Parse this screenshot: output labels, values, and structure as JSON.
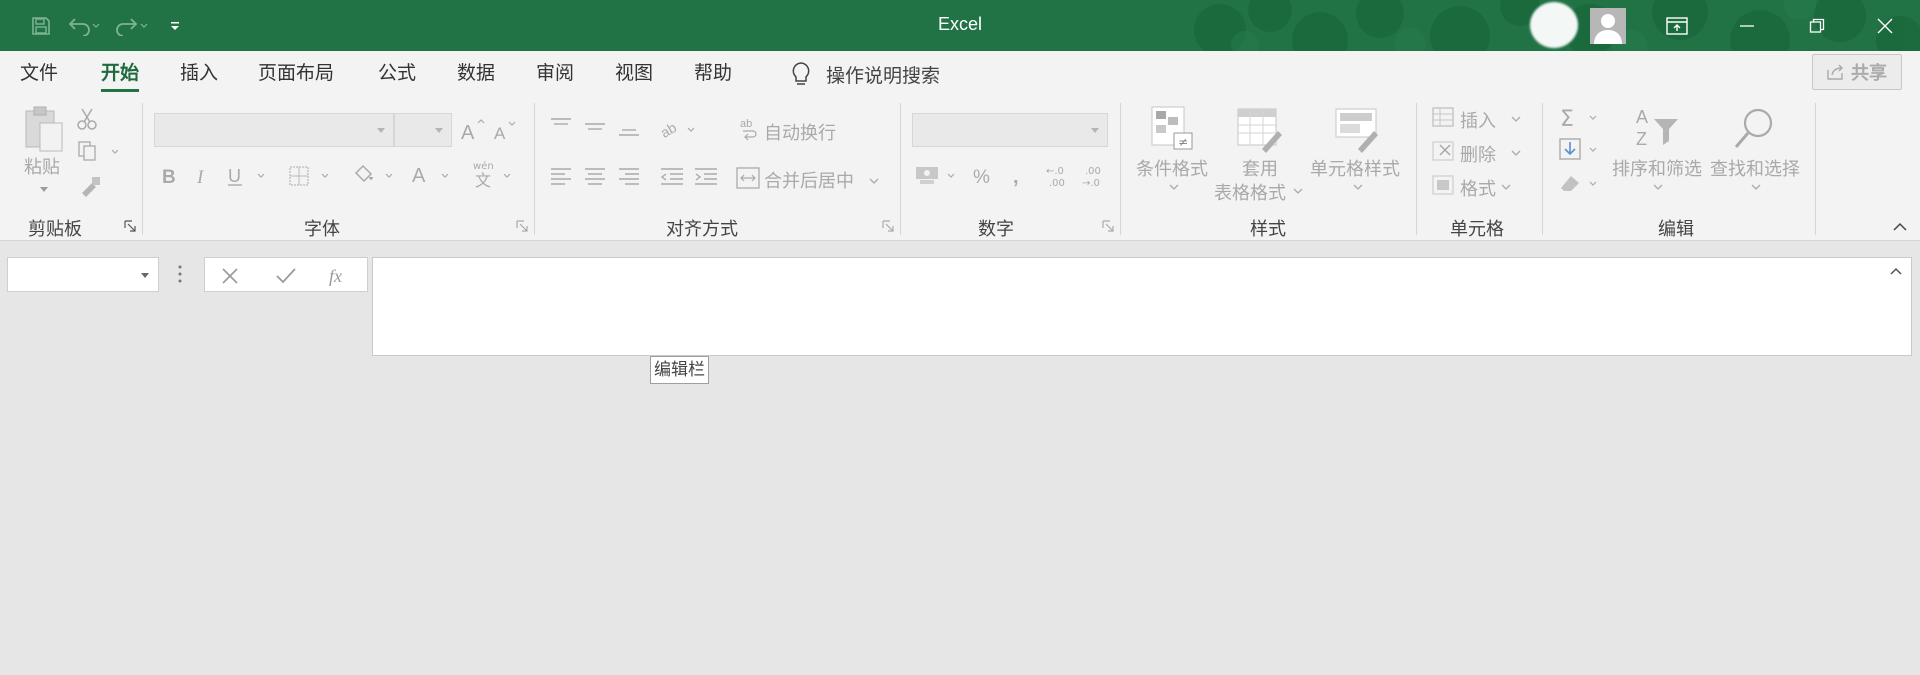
{
  "window": {
    "title": "Excel",
    "accent_color": "#217346"
  },
  "quick_access": {
    "icons": [
      "save-icon",
      "undo-icon",
      "redo-icon",
      "customize-qat-icon"
    ]
  },
  "window_controls": {
    "icons": [
      "ribbon-display-options-icon",
      "minimize-icon",
      "restore-icon",
      "close-icon"
    ]
  },
  "menu": {
    "tabs": [
      {
        "label": "文件",
        "active": false
      },
      {
        "label": "开始",
        "active": true
      },
      {
        "label": "插入",
        "active": false
      },
      {
        "label": "页面布局",
        "active": false
      },
      {
        "label": "公式",
        "active": false
      },
      {
        "label": "数据",
        "active": false
      },
      {
        "label": "审阅",
        "active": false
      },
      {
        "label": "视图",
        "active": false
      },
      {
        "label": "帮助",
        "active": false
      }
    ],
    "tell_me": "操作说明搜索",
    "share": "共享"
  },
  "ribbon": {
    "clipboard": {
      "label": "剪贴板",
      "paste": "粘贴"
    },
    "font": {
      "label": "字体",
      "font_name": "",
      "font_size": ""
    },
    "alignment": {
      "label": "对齐方式",
      "wrap_text": "自动换行",
      "merge_center": "合并后居中"
    },
    "number": {
      "label": "数字",
      "format": ""
    },
    "styles": {
      "label": "样式",
      "conditional_format": "条件格式",
      "format_table_1": "套用",
      "format_table_2": "表格格式",
      "cell_styles": "单元格样式"
    },
    "cells": {
      "label": "单元格",
      "insert": "插入",
      "delete": "删除",
      "format": "格式"
    },
    "editing": {
      "label": "编辑",
      "sort_filter": "排序和筛选",
      "find_select": "查找和选择"
    }
  },
  "formula_bar": {
    "name_box": "",
    "formula": "",
    "tooltip": "编辑栏"
  }
}
